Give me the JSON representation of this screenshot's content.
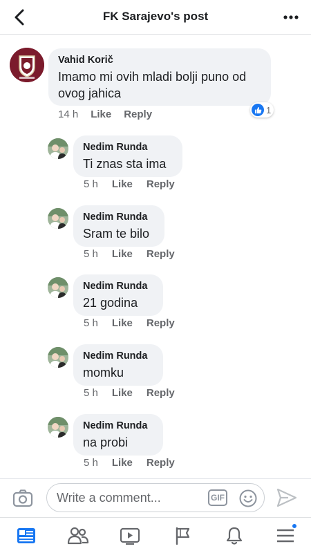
{
  "header": {
    "title": "FK Sarajevo's post",
    "back_icon": "back-arrow-icon",
    "more_icon": "more-dots-icon"
  },
  "comments": [
    {
      "author": "Vahid Korič",
      "text": "Imamo mi ovih mladi bolji puno od ovog jahica",
      "time": "14 h",
      "like_label": "Like",
      "reply_label": "Reply",
      "reaction_count": "1",
      "avatar_icon": "fk-sarajevo-crest-avatar"
    }
  ],
  "replies": [
    {
      "author": "Nedim Runda",
      "text": "Ti znas sta ima",
      "time": "5 h",
      "like_label": "Like",
      "reply_label": "Reply"
    },
    {
      "author": "Nedim Runda",
      "text": "Sram te bilo",
      "time": "5 h",
      "like_label": "Like",
      "reply_label": "Reply"
    },
    {
      "author": "Nedim Runda",
      "text": "21 godina",
      "time": "5 h",
      "like_label": "Like",
      "reply_label": "Reply"
    },
    {
      "author": "Nedim Runda",
      "text": "momku",
      "time": "5 h",
      "like_label": "Like",
      "reply_label": "Reply"
    },
    {
      "author": "Nedim Runda",
      "text": "na probi",
      "time": "5 h",
      "like_label": "Like",
      "reply_label": "Reply"
    }
  ],
  "composer": {
    "placeholder": "Write a comment...",
    "gif_label": "GIF",
    "camera_icon": "camera-icon",
    "emoji_icon": "emoji-icon",
    "send_icon": "send-icon"
  },
  "tabbar": {
    "items": [
      "news-feed-icon",
      "friends-icon",
      "watch-icon",
      "pages-flag-icon",
      "notifications-bell-icon",
      "menu-icon"
    ],
    "active": "news-feed-icon",
    "accent": "#1877f2"
  },
  "colors": {
    "bubble": "#f0f2f5",
    "meta_text": "#65676b",
    "accent": "#1877f2"
  }
}
